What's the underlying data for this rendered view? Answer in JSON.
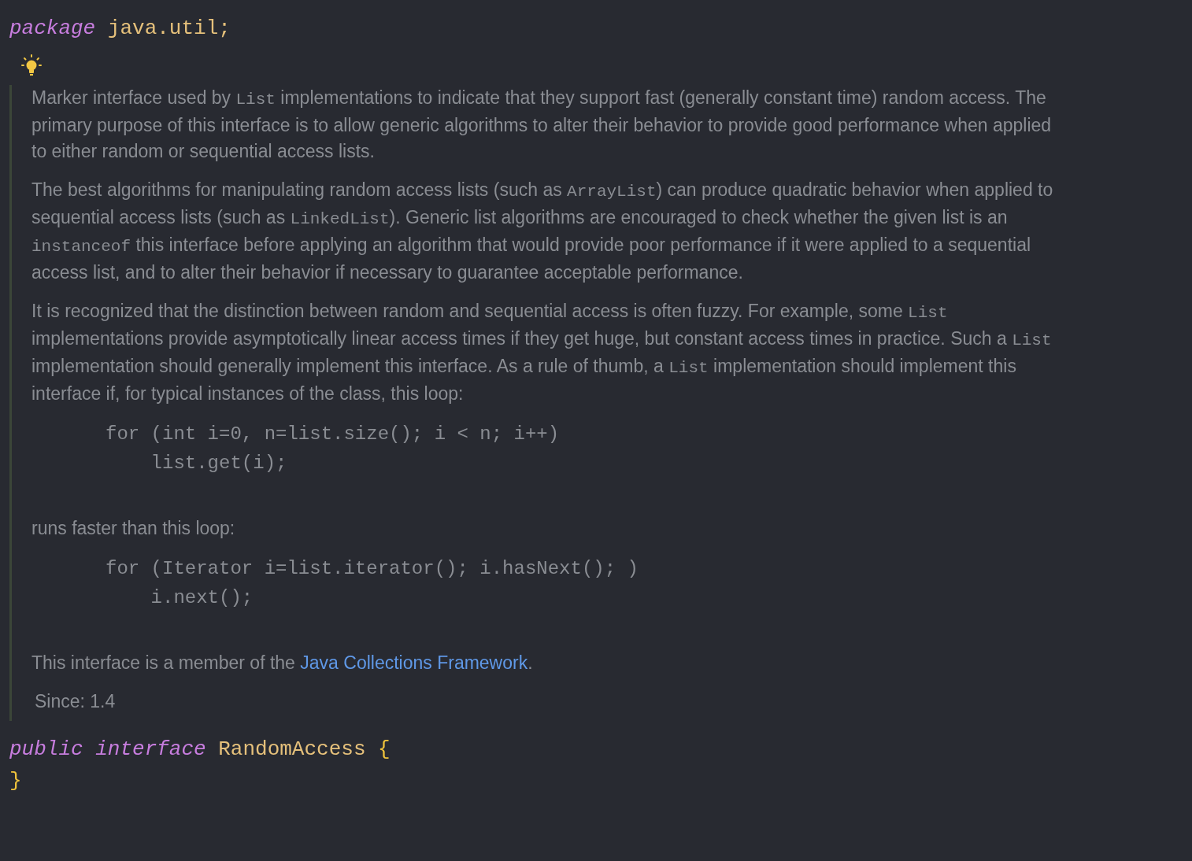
{
  "header_line": [
    {
      "kind": "keyword",
      "text": "package"
    },
    {
      "kind": "name",
      "text": " java.util;"
    }
  ],
  "doc": {
    "paragraphs": [
      {
        "kind": "text",
        "segments": [
          {
            "kind": "text",
            "text": "Marker interface used by "
          },
          {
            "kind": "code",
            "text": "List"
          },
          {
            "kind": "text",
            "text": " implementations to indicate that they support fast (generally constant time) random access. The primary purpose of this interface is to allow generic algorithms to alter their behavior to provide good performance when applied to either random or sequential access lists."
          }
        ]
      },
      {
        "kind": "text",
        "segments": [
          {
            "kind": "text",
            "text": "The best algorithms for manipulating random access lists (such as "
          },
          {
            "kind": "code",
            "text": "ArrayList"
          },
          {
            "kind": "text",
            "text": ") can produce quadratic behavior when applied to sequential access lists (such as "
          },
          {
            "kind": "code",
            "text": "LinkedList"
          },
          {
            "kind": "text",
            "text": "). Generic list algorithms are encouraged to check whether the given list is an "
          },
          {
            "kind": "code",
            "text": "instanceof"
          },
          {
            "kind": "text",
            "text": " this interface before applying an algorithm that would provide poor performance if it were applied to a sequential access list, and to alter their behavior if necessary to guarantee acceptable performance."
          }
        ]
      },
      {
        "kind": "text",
        "segments": [
          {
            "kind": "text",
            "text": "It is recognized that the distinction between random and sequential access is often fuzzy. For example, some "
          },
          {
            "kind": "code",
            "text": "List"
          },
          {
            "kind": "text",
            "text": " implementations provide asymptotically linear access times if they get huge, but constant access times in practice. Such a "
          },
          {
            "kind": "code",
            "text": "List"
          },
          {
            "kind": "text",
            "text": " implementation should generally implement this interface. As a rule of thumb, a "
          },
          {
            "kind": "code",
            "text": "List"
          },
          {
            "kind": "text",
            "text": " implementation should implement this interface if, for typical instances of the class, this loop:"
          }
        ]
      },
      {
        "kind": "code",
        "lines": [
          "for (int i=0, n=list.size(); i < n; i++)",
          "    list.get(i);"
        ]
      },
      {
        "kind": "text",
        "segments": [
          {
            "kind": "text",
            "text": "runs faster than this loop:"
          }
        ]
      },
      {
        "kind": "code",
        "lines": [
          "for (Iterator i=list.iterator(); i.hasNext(); )",
          "    i.next();"
        ]
      },
      {
        "kind": "text",
        "segments": [
          {
            "kind": "text",
            "text": "This interface is a member of the "
          },
          {
            "kind": "link",
            "text": "Java Collections Framework"
          },
          {
            "kind": "text",
            "text": "."
          }
        ]
      }
    ],
    "since": "Since: 1.4"
  },
  "code_lines": [
    [
      {
        "kind": "keyword",
        "text": "public"
      },
      {
        "kind": "keyword",
        "text": " interface"
      },
      {
        "kind": "name",
        "text": " RandomAccess"
      },
      {
        "kind": "brace",
        "text": " {"
      }
    ],
    [
      {
        "kind": "brace",
        "text": "}"
      }
    ]
  ]
}
